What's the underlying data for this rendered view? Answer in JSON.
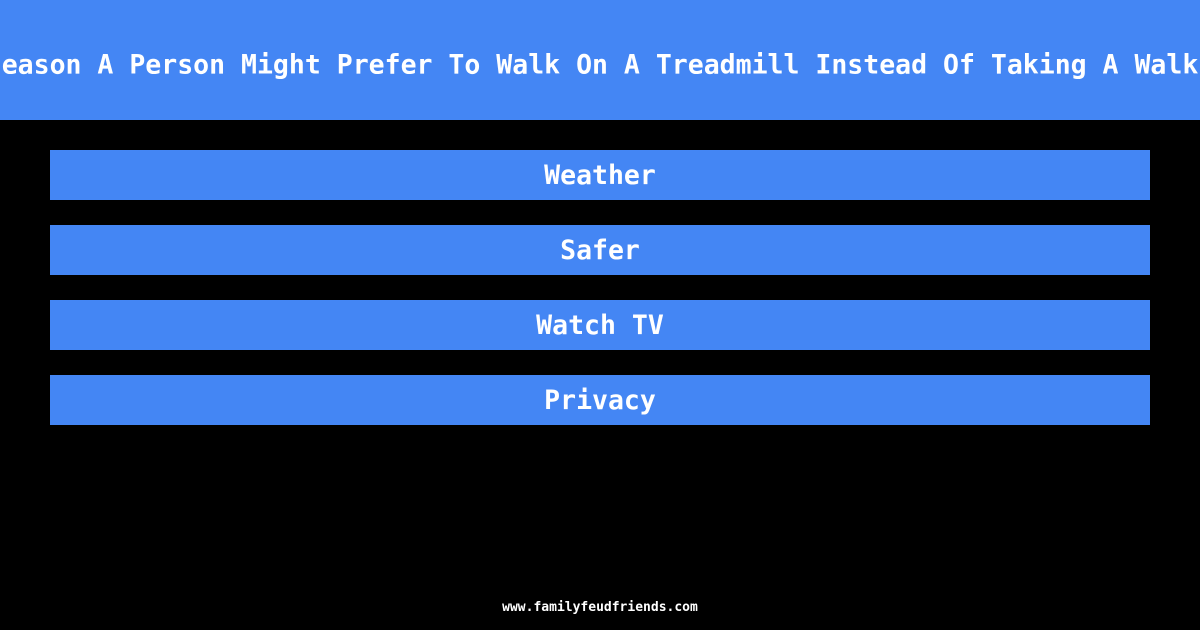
{
  "header": {
    "title": "eason A Person Might Prefer To Walk On A Treadmill Instead Of Taking A Walk"
  },
  "answers": [
    {
      "label": "Weather"
    },
    {
      "label": "Safer"
    },
    {
      "label": "Watch TV"
    },
    {
      "label": "Privacy"
    }
  ],
  "footer": {
    "url": "www.familyfeudfriends.com"
  },
  "colors": {
    "accent": "#4486f4",
    "background": "#000000",
    "text": "#ffffff"
  }
}
